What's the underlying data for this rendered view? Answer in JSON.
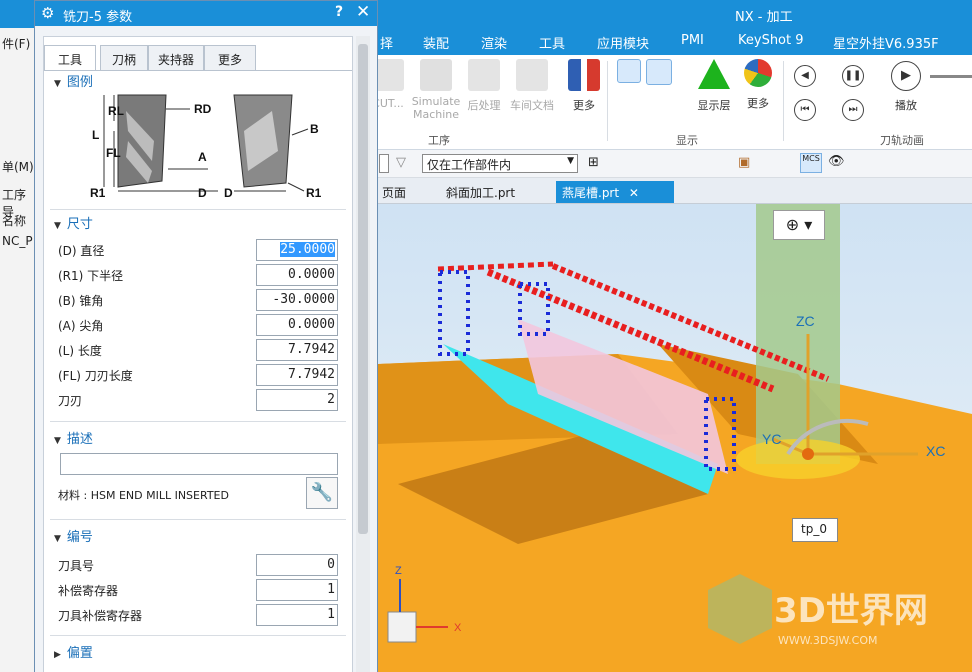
{
  "app": {
    "title": "NX - 加工"
  },
  "menu": {
    "items": [
      "择",
      "装配",
      "渲染",
      "工具",
      "应用模块",
      "PMI",
      "KeyShot 9",
      "星空外挂V6.935F"
    ]
  },
  "ribbon": {
    "cut": "CUT...",
    "simulate_machine": "Simulate Machine",
    "postprocess": "后处理",
    "shop_doc": "车间文档",
    "more1": "更多",
    "display_layer": "显示层",
    "more2": "更多",
    "play": "播放",
    "group_ops": "工序",
    "group_display": "显示",
    "group_animation": "刀轨动画"
  },
  "selbar": {
    "filter_value": "仅在工作部件内"
  },
  "doc_tabs": {
    "t1": "页面",
    "t2": "斜面加工.prt",
    "t3": "燕尾槽.prt"
  },
  "left_strip": {
    "file": "件(F)",
    "menu": "单(M)",
    "ops": "工序导",
    "name": "名称",
    "nc": "NC_P"
  },
  "dialog": {
    "title": "铣刀-5 参数",
    "help": "?",
    "close": "✕",
    "tabs": [
      "工具",
      "刀柄",
      "夹持器",
      "更多"
    ],
    "legend_title": "图例",
    "legend_labels": {
      "rl": "RL",
      "rd": "RD",
      "l": "L",
      "fl": "FL",
      "a": "A",
      "b": "B",
      "d": "D",
      "r1": "R1"
    },
    "dims_title": "尺寸",
    "dims": [
      {
        "label": "(D) 直径",
        "value": "25.0000"
      },
      {
        "label": "(R1) 下半径",
        "value": "0.0000"
      },
      {
        "label": "(B) 锥角",
        "value": "-30.0000"
      },
      {
        "label": "(A) 尖角",
        "value": "0.0000"
      },
      {
        "label": "(L) 长度",
        "value": "7.7942"
      },
      {
        "label": "(FL) 刀刃长度",
        "value": "7.7942"
      },
      {
        "label": "刀刃",
        "value": "2"
      }
    ],
    "desc_title": "描述",
    "desc_value": "",
    "material": "材料 : HSM END MILL INSERTED",
    "num_title": "编号",
    "numbers": [
      {
        "label": "刀具号",
        "value": "0"
      },
      {
        "label": "补偿寄存器",
        "value": "1"
      },
      {
        "label": "刀具补偿寄存器",
        "value": "1"
      }
    ],
    "offset_title": "偏置"
  },
  "viewport": {
    "zc": "ZC",
    "yc": "YC",
    "xc": "XC",
    "tp": "tp_0",
    "z": "Z",
    "x": "X",
    "watermark": "3D世界网",
    "watermark_url": "WWW.3DSJW.COM"
  },
  "colors": {
    "titlebar": "#1a8fd8",
    "stock": "#f5a623",
    "toolpath": "#e81f1f",
    "tool": "#9fc27a"
  }
}
